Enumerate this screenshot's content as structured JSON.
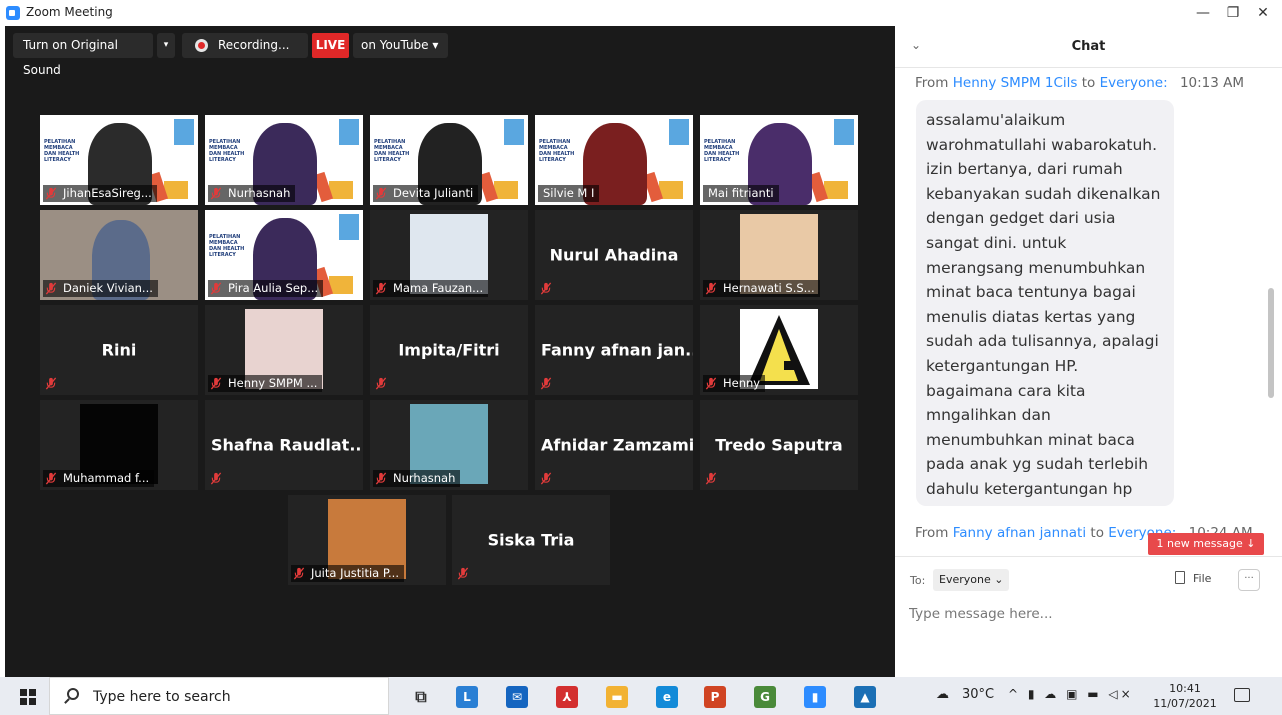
{
  "window": {
    "title": "Zoom Meeting",
    "minimize": "—",
    "restore": "❐",
    "close": "✕"
  },
  "toolbar": {
    "original_sound": "Turn on Original Sound",
    "dropdown_arrow": "▾",
    "recording": "Recording...",
    "live": "LIVE",
    "youtube": "on YouTube ▾"
  },
  "participants": [
    {
      "name": "JihanEsaSireg...",
      "type": "slide",
      "muted": true
    },
    {
      "name": "Nurhasnah",
      "type": "slide",
      "muted": true
    },
    {
      "name": "Devita Julianti",
      "type": "slide",
      "muted": true
    },
    {
      "name": "Silvie M I",
      "type": "slide",
      "muted": false,
      "active": true
    },
    {
      "name": "Mai fitrianti",
      "type": "slide",
      "muted": false
    },
    {
      "name": "Daniek Vivian...",
      "type": "video",
      "muted": true
    },
    {
      "name": "Pira Aulia Sep...",
      "type": "slide",
      "muted": true
    },
    {
      "name": "Mama Fauzan...",
      "type": "photo",
      "muted": true
    },
    {
      "name": "",
      "display": "Nurul Ahadina",
      "type": "name",
      "muted": true
    },
    {
      "name": "Hernawati S.S...",
      "type": "photo",
      "muted": true
    },
    {
      "name": "",
      "display": "Rini",
      "type": "name",
      "muted": true
    },
    {
      "name": "Henny SMPM ...",
      "type": "photo",
      "muted": true
    },
    {
      "name": "",
      "display": "Impita/Fitri",
      "type": "name",
      "muted": true
    },
    {
      "name": "",
      "display": "Fanny afnan jan...",
      "type": "name",
      "muted": true
    },
    {
      "name": "Henny",
      "type": "photo",
      "muted": true
    },
    {
      "name": "Muhammad f...",
      "type": "photo",
      "muted": true
    },
    {
      "name": "",
      "display": "Shafna Raudlat...",
      "type": "name",
      "muted": true
    },
    {
      "name": "Nurhasnah",
      "type": "photo",
      "muted": true
    },
    {
      "name": "",
      "display": "Afnidar Zamzami",
      "type": "name",
      "muted": true
    },
    {
      "name": "",
      "display": "Tredo Saputra",
      "type": "name",
      "muted": true
    },
    {
      "name": "Juita Justitia P...",
      "type": "photo",
      "muted": true
    },
    {
      "name": "",
      "display": "Siska Tria",
      "type": "name",
      "muted": true
    }
  ],
  "slide_text": "PELATIHAN MEMBACA DAN HEALTH LITERACY",
  "chat": {
    "title": "Chat",
    "collapse": "⌄",
    "messages": [
      {
        "from_label": "From",
        "sender": "Henny SMPM 1Cils",
        "to_label": "to",
        "recipient": "Everyone:",
        "time": "10:13 AM",
        "text": "assalamu'alaikum warohmatullahi wabarokatuh. izin bertanya, dari rumah kebanyakan sudah dikenalkan dengan gedget dari usia sangat dini. untuk merangsang menumbuhkan minat baca tentunya bagai menulis diatas kertas yang sudah ada tulisannya, apalagi ketergantungan HP. bagaimana cara kita mngalihkan dan menumbuhkan minat baca pada anak yg sudah terlebih dahulu ketergantungan hp"
      },
      {
        "from_label": "From",
        "sender": "Fanny afnan jannati",
        "to_label": "to",
        "recipient": "Everyone:",
        "time": "10:24 AM"
      }
    ],
    "new_message": "1 new message ↓",
    "to_label": "To:",
    "to_value": "Everyone ⌄",
    "file_label": "File",
    "more_label": "···",
    "input_placeholder": "Type message here..."
  },
  "taskbar": {
    "search_placeholder": "Type here to search",
    "weather": "30°C",
    "tray_icons": "^ ▮ ☁ ▣ ▬ ◁×",
    "time": "10:41",
    "date": "11/07/2021",
    "app_icons": [
      {
        "name": "task-view-icon",
        "glyph": "⧉",
        "color": "#e9ecf2"
      },
      {
        "name": "l-app-icon",
        "glyph": "L",
        "color": "#2a7fd4"
      },
      {
        "name": "mail-icon",
        "glyph": "✉",
        "color": "#1565c0"
      },
      {
        "name": "pdf-icon",
        "glyph": "⅄",
        "color": "#d32f2f"
      },
      {
        "name": "folder-icon",
        "glyph": "▬",
        "color": "#f2b233"
      },
      {
        "name": "edge-icon",
        "glyph": "e",
        "color": "#138ad8"
      },
      {
        "name": "powerpoint-icon",
        "glyph": "P",
        "color": "#d04423"
      },
      {
        "name": "chrome-icon",
        "glyph": "G",
        "color": "#4a8a3a"
      },
      {
        "name": "zoom-icon",
        "glyph": "▮",
        "color": "#2d8cff"
      },
      {
        "name": "photos-icon",
        "glyph": "▲",
        "color": "#1b6fb5"
      }
    ]
  }
}
